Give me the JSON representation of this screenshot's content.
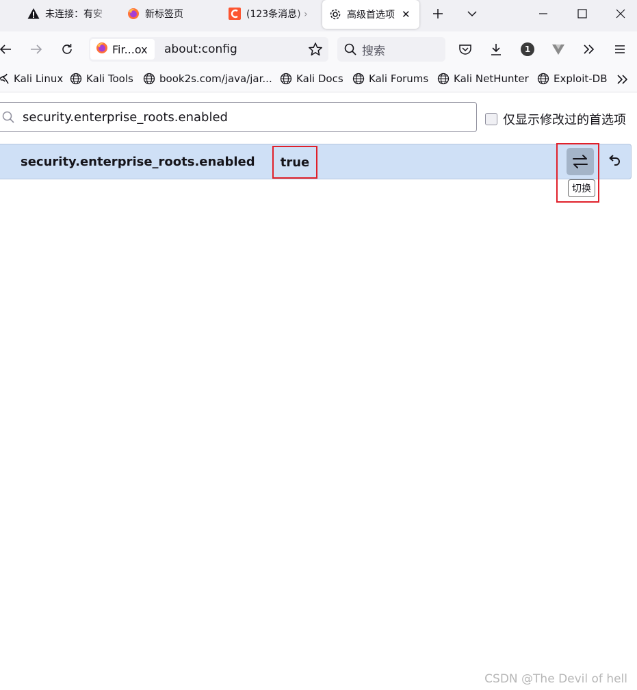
{
  "tabs": [
    {
      "label": "未连接：有安",
      "icon": "warning-icon",
      "active": false
    },
    {
      "label": "新标签页",
      "icon": "firefox-icon",
      "active": false
    },
    {
      "label": "(123条消息) ›",
      "icon": "csdn-icon",
      "active": false
    },
    {
      "label": "高级首选项",
      "icon": "gear-icon",
      "active": true
    }
  ],
  "nav": {
    "identity_label": "Fir...ox",
    "url": "about:config",
    "search_placeholder": "搜索",
    "notification_badge": "1"
  },
  "bookmarks": [
    {
      "label": "Kali Linux",
      "icon": "kali-dragon-icon"
    },
    {
      "label": "Kali Tools",
      "icon": "globe-icon"
    },
    {
      "label": "book2s.com/java/jar...",
      "icon": "globe-icon"
    },
    {
      "label": "Kali Docs",
      "icon": "globe-icon"
    },
    {
      "label": "Kali Forums",
      "icon": "globe-icon"
    },
    {
      "label": "Kali NetHunter",
      "icon": "globe-icon"
    },
    {
      "label": "Exploit-DB",
      "icon": "globe-icon"
    }
  ],
  "config": {
    "search_value": "security.enterprise_roots.enabled",
    "show_modified_label": "仅显示修改过的首选项",
    "preference": {
      "name": "security.enterprise_roots.enabled",
      "value": "true"
    },
    "toggle_tooltip": "切换"
  },
  "watermark": "CSDN @The Devil of hell",
  "colors": {
    "row_background": "#cfe0f6",
    "highlight_border": "#e0202a",
    "toggle_button": "#a4b4c8"
  }
}
